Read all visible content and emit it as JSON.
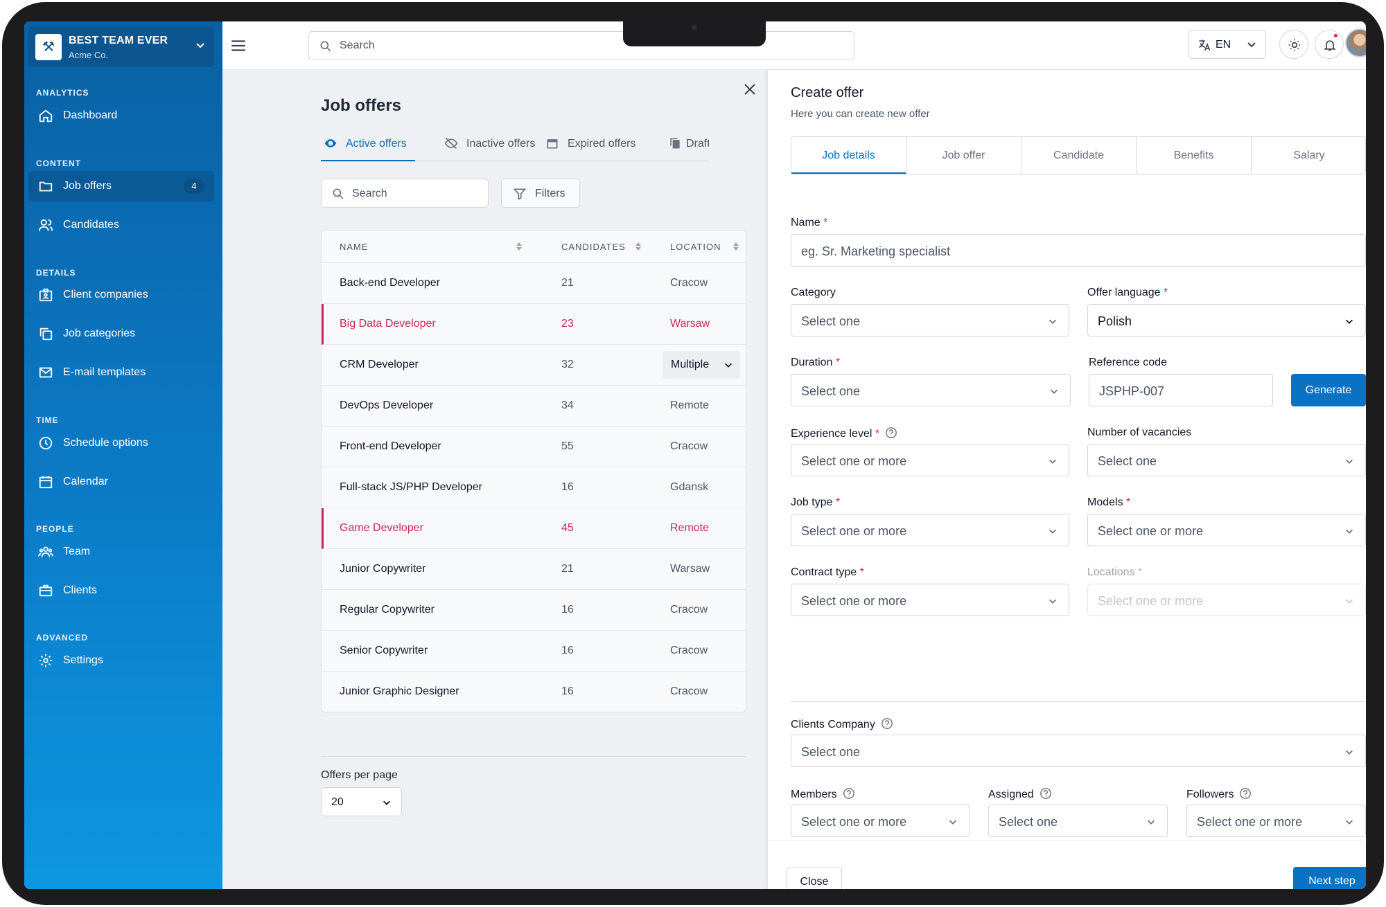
{
  "team": {
    "name": "BEST TEAM EVER",
    "company": "Acme Co."
  },
  "sidebar": {
    "sections": [
      {
        "title": "ANALYTICS",
        "items": [
          {
            "label": "Dashboard",
            "icon": "home-icon"
          }
        ]
      },
      {
        "title": "CONTENT",
        "items": [
          {
            "label": "Job offers",
            "icon": "folder-icon",
            "badge": "4",
            "active": true
          },
          {
            "label": "Candidates",
            "icon": "users-icon"
          }
        ]
      },
      {
        "title": "DETAILS",
        "items": [
          {
            "label": "Client companies",
            "icon": "id-card-icon"
          },
          {
            "label": "Job categories",
            "icon": "copy-icon"
          },
          {
            "label": "E-mail templates",
            "icon": "mail-icon"
          }
        ]
      },
      {
        "title": "TIME",
        "items": [
          {
            "label": "Schedule options",
            "icon": "clock-icon"
          },
          {
            "label": "Calendar",
            "icon": "calendar-icon"
          }
        ]
      },
      {
        "title": "PEOPLE",
        "items": [
          {
            "label": "Team",
            "icon": "team-icon"
          },
          {
            "label": "Clients",
            "icon": "briefcase-icon"
          }
        ]
      },
      {
        "title": "ADVANCED",
        "items": [
          {
            "label": "Settings",
            "icon": "gear-icon"
          }
        ]
      }
    ]
  },
  "topbar": {
    "search_placeholder": "Search",
    "language": "EN"
  },
  "main": {
    "title": "Job offers",
    "tabs": [
      {
        "label": "Active offers",
        "icon": "eye-icon",
        "active": true
      },
      {
        "label": "Inactive offers",
        "icon": "eye-off-icon"
      },
      {
        "label": "Expired offers",
        "icon": "calendar-icon"
      },
      {
        "label": "Drafts",
        "icon": "copy-icon"
      }
    ],
    "search_placeholder": "Search",
    "filters_label": "Filters",
    "table": {
      "headers": [
        "NAME",
        "CANDIDATES",
        "LOCATION"
      ],
      "rows": [
        {
          "name": "Back-end Developer",
          "candidates": "21",
          "location": "Cracow"
        },
        {
          "name": "Big Data Developer",
          "candidates": "23",
          "location": "Warsaw",
          "highlight": true
        },
        {
          "name": "CRM Developer",
          "candidates": "32",
          "location": "Multiple",
          "dropdown": true
        },
        {
          "name": "DevOps Developer",
          "candidates": "34",
          "location": "Remote"
        },
        {
          "name": "Front-end Developer",
          "candidates": "55",
          "location": "Cracow"
        },
        {
          "name": "Full-stack JS/PHP Developer",
          "candidates": "16",
          "location": "Gdansk"
        },
        {
          "name": "Game Developer",
          "candidates": "45",
          "location": "Remote",
          "highlight": true
        },
        {
          "name": "Junior Copywriter",
          "candidates": "21",
          "location": "Warsaw"
        },
        {
          "name": "Regular Copywriter",
          "candidates": "16",
          "location": "Cracow"
        },
        {
          "name": "Senior Copywriter",
          "candidates": "16",
          "location": "Cracow"
        },
        {
          "name": "Junior Graphic Designer",
          "candidates": "16",
          "location": "Cracow"
        }
      ]
    },
    "per_page": {
      "label": "Offers per page",
      "value": "20"
    }
  },
  "panel": {
    "title": "Create offer",
    "subtitle": "Here you can create new offer",
    "tabs": [
      "Job details",
      "Job offer",
      "Candidate",
      "Benefits",
      "Salary"
    ],
    "name": {
      "label": "Name",
      "placeholder": "eg. Sr. Marketing specialist"
    },
    "category": {
      "label": "Category",
      "value": "Select one"
    },
    "offer_language": {
      "label": "Offer language",
      "value": "Polish"
    },
    "duration": {
      "label": "Duration",
      "value": "Select one"
    },
    "reference_code": {
      "label": "Reference code",
      "value": "JSPHP-007"
    },
    "generate_label": "Generate",
    "experience_level": {
      "label": "Experience level",
      "value": "Select one or more"
    },
    "vacancies": {
      "label": "Number of vacancies",
      "value": "Select one"
    },
    "job_type": {
      "label": "Job type",
      "value": "Select one or more"
    },
    "models": {
      "label": "Models",
      "value": "Select one or more"
    },
    "contract_type": {
      "label": "Contract type",
      "value": "Select one or more"
    },
    "locations": {
      "label": "Locations",
      "value": "Select one or more"
    },
    "clients_company": {
      "label": "Clients Company",
      "value": "Select one"
    },
    "members": {
      "label": "Members",
      "value": "Select one or more"
    },
    "assigned": {
      "label": "Assigned",
      "value": "Select one"
    },
    "followers": {
      "label": "Followers",
      "value": "Select one or more"
    },
    "close_label": "Close",
    "next_label": "Next step"
  },
  "colors": {
    "accent": "#0a72c2",
    "sidebar_top": "#0a60a3",
    "sidebar_bottom": "#0d97e2",
    "highlight": "#c8295b",
    "required": "#e11d48"
  }
}
